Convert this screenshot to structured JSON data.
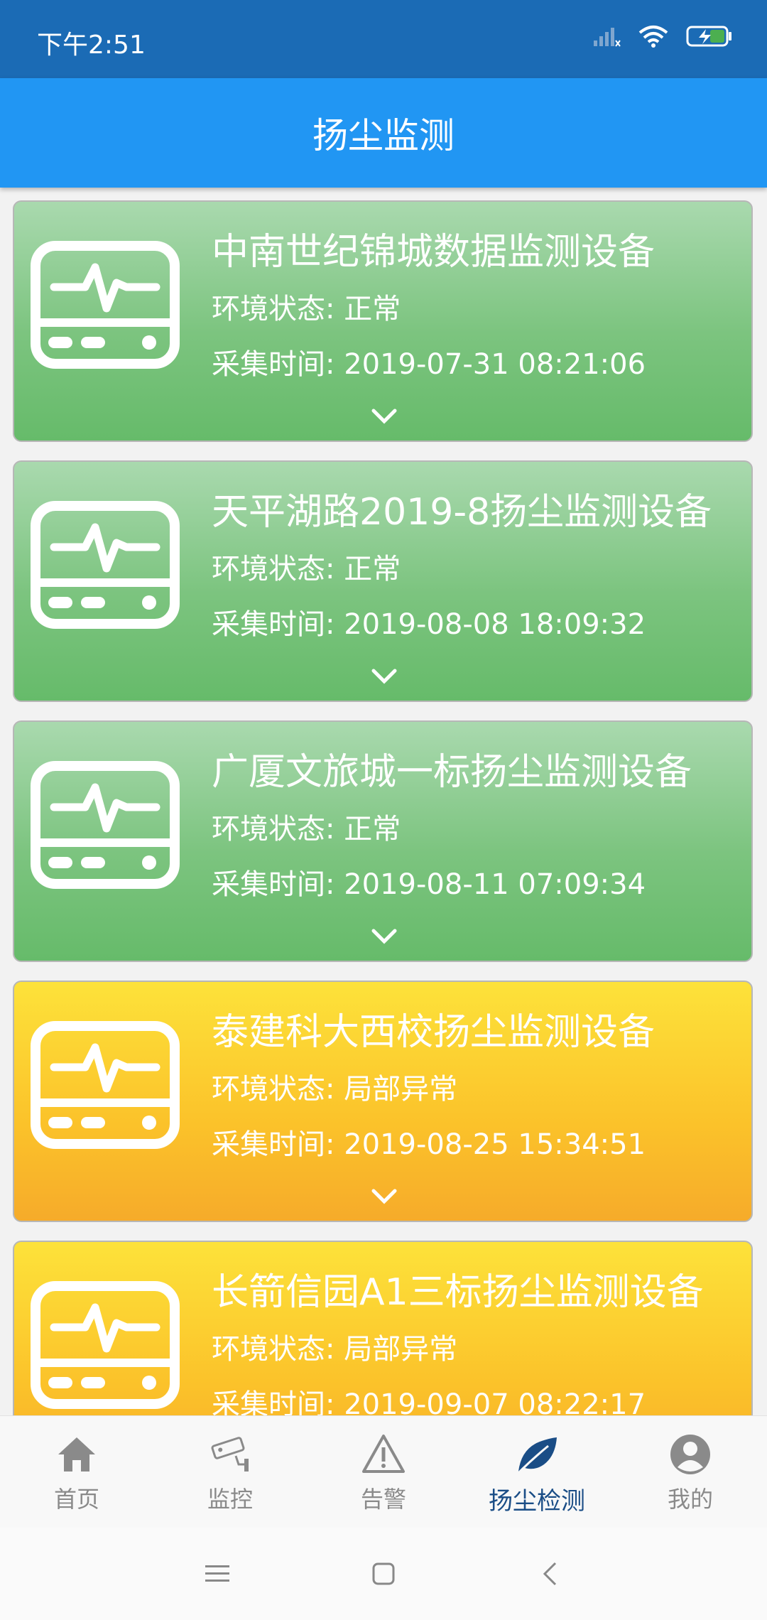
{
  "status": {
    "time": "下午2:51"
  },
  "header": {
    "title": "扬尘监测"
  },
  "devices": [
    {
      "name": "中南世纪锦城数据监测设备",
      "status": "环境状态: 正常",
      "time": "采集时间: 2019-07-31 08:21:06",
      "color": "#66bb6a"
    },
    {
      "name": "天平湖路2019-8扬尘监测设备",
      "status": "环境状态: 正常",
      "time": "采集时间: 2019-08-08 18:09:32",
      "color": "#66bb6a"
    },
    {
      "name": "广厦文旅城一标扬尘监测设备",
      "status": "环境状态: 正常",
      "time": "采集时间: 2019-08-11 07:09:34",
      "color": "#66bb6a"
    },
    {
      "name": "泰建科大西校扬尘监测设备",
      "status": "环境状态: 局部异常",
      "time": "采集时间: 2019-08-25 15:34:51",
      "color": "#f9b92a"
    },
    {
      "name": "长箭信园A1三标扬尘监测设备",
      "status": "环境状态: 局部异常",
      "time": "采集时间: 2019-09-07 08:22:17",
      "color": "#f9b92a"
    }
  ],
  "nav": [
    {
      "label": "首页",
      "icon": "home-icon"
    },
    {
      "label": "监控",
      "icon": "camera-icon"
    },
    {
      "label": "告警",
      "icon": "warning-icon"
    },
    {
      "label": "扬尘检测",
      "icon": "leaf-icon",
      "active": true
    },
    {
      "label": "我的",
      "icon": "user-icon"
    }
  ],
  "colors": {
    "status_bar": "#1b6bb5",
    "app_bar": "#2196f3",
    "nav_active": "#1a4d86"
  }
}
